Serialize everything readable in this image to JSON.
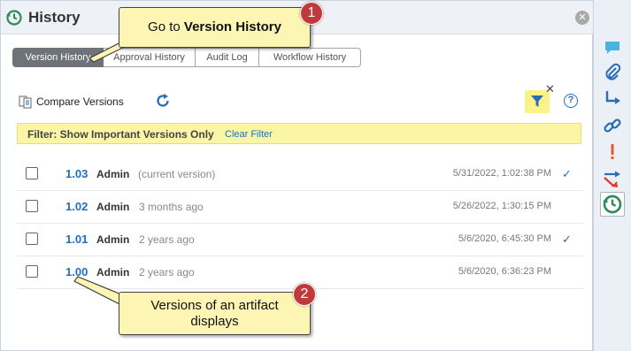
{
  "header": {
    "title": "History",
    "icon": "history-icon",
    "close_icon": "close-icon"
  },
  "tabs": [
    {
      "label": "Version History",
      "selected": true
    },
    {
      "label": "Approval History",
      "selected": false
    },
    {
      "label": "Audit Log",
      "selected": false
    },
    {
      "label": "Workflow History",
      "selected": false
    }
  ],
  "toolbar": {
    "compare_label": "Compare Versions",
    "compare_icon": "compare-document-icon",
    "refresh_icon": "refresh-icon",
    "filter_icon": "filter-icon",
    "help_label": "?"
  },
  "filter_bar": {
    "label": "Filter:  Show Important Versions Only",
    "clear_label": "Clear Filter"
  },
  "versions": [
    {
      "version": "1.03",
      "user": "Admin",
      "note": "(current version)",
      "date": "5/31/2022, 1:02:38 PM",
      "important": true
    },
    {
      "version": "1.02",
      "user": "Admin",
      "note": "3 months ago",
      "date": "5/26/2022, 1:30:15 PM",
      "important": false
    },
    {
      "version": "1.01",
      "user": "Admin",
      "note": "2 years ago",
      "date": "5/6/2020, 6:45:30 PM",
      "important": true
    },
    {
      "version": "1.00",
      "user": "Admin",
      "note": "2 years ago",
      "date": "5/6/2020, 6:36:23 PM",
      "important": false
    }
  ],
  "sidebar": {
    "icons": [
      "discussion-icon",
      "attachment-icon",
      "relationship-icon",
      "link-icon",
      "flag-icon",
      "review-icon",
      "history-icon"
    ],
    "active": "history-icon"
  },
  "callouts": [
    {
      "number": "1",
      "text_plain": "Go to ",
      "text_bold": "Version History"
    },
    {
      "number": "2",
      "text_plain": "Versions of an artifact displays"
    }
  ],
  "colors": {
    "accent": "#1d6fc4",
    "callout_bg": "#fdf5b4",
    "badge": "#c0393b",
    "filter_bg": "#fbf6a6"
  }
}
